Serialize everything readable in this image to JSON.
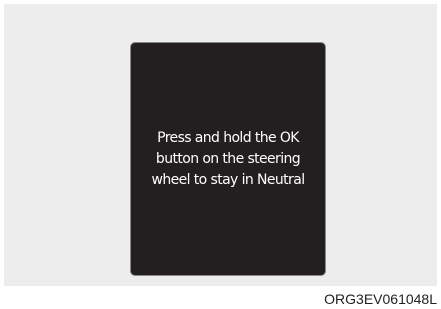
{
  "display": {
    "message_lines": [
      "Press and hold the OK",
      "button on the steering",
      "wheel to stay in Neutral"
    ]
  },
  "figure": {
    "code": "ORG3EV061048L"
  },
  "colors": {
    "panel_background": "#ededed",
    "display_background": "#231f20",
    "display_border": "#8a8a8a",
    "message_text": "#ffffff"
  }
}
